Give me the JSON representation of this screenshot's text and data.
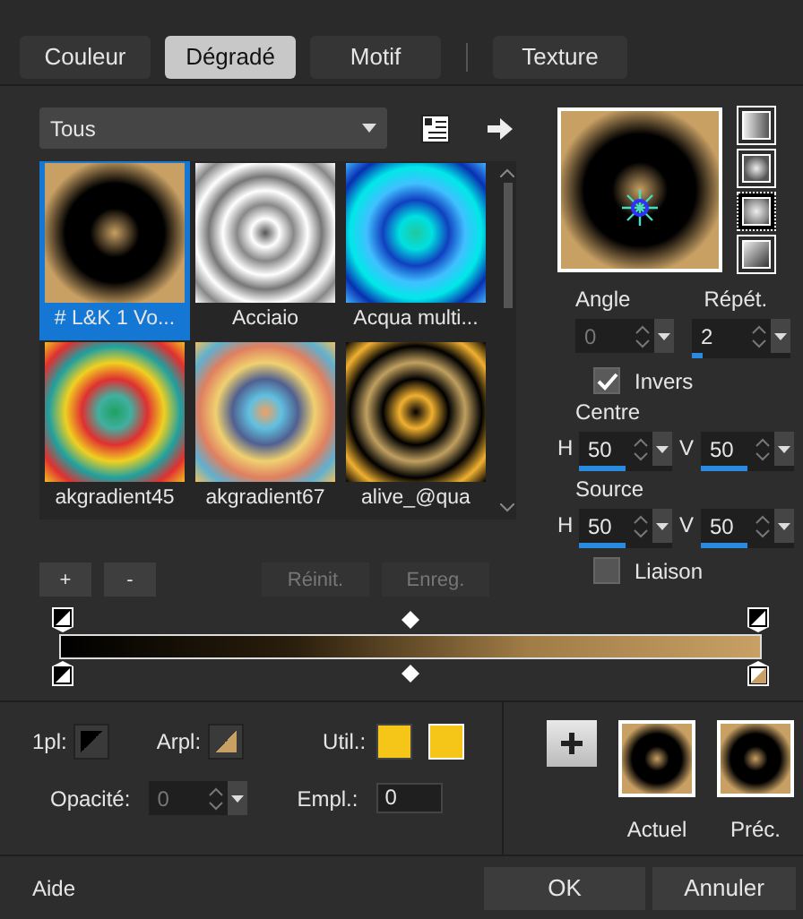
{
  "tabs": [
    {
      "label": "Couleur",
      "selected": false
    },
    {
      "label": "Dégradé",
      "selected": true
    },
    {
      "label": "Motif",
      "selected": false
    },
    {
      "label": "Texture",
      "selected": false
    }
  ],
  "category": {
    "value": "Tous"
  },
  "gradients": [
    {
      "name": "# L&K 1 Vo...",
      "selected": true
    },
    {
      "name": "Acciaio",
      "selected": false
    },
    {
      "name": "Acqua multi...",
      "selected": false
    },
    {
      "name": "akgradient45",
      "selected": false
    },
    {
      "name": "akgradient67",
      "selected": false
    },
    {
      "name": "alive_@qua",
      "selected": false
    }
  ],
  "library_buttons": [
    {
      "label": "+",
      "disabled": false
    },
    {
      "label": "-",
      "disabled": false
    },
    {
      "label": "Réinit.",
      "disabled": true
    },
    {
      "label": "Enreg.",
      "disabled": true
    }
  ],
  "styles": [
    {
      "kind": "linear",
      "selected": false
    },
    {
      "kind": "rectangular",
      "selected": false
    },
    {
      "kind": "radial",
      "selected": true
    },
    {
      "kind": "sunburst",
      "selected": false
    }
  ],
  "angle": {
    "label": "Angle",
    "value": "0",
    "disabled": true
  },
  "repeat": {
    "label": "Répét.",
    "value": "2",
    "disabled": false,
    "level": 0.1
  },
  "invert": {
    "label": "Invers",
    "checked": true
  },
  "centre": {
    "label": "Centre",
    "h": {
      "label": "H",
      "value": "50",
      "level": 0.5
    },
    "v": {
      "label": "V",
      "value": "50",
      "level": 0.5
    }
  },
  "source": {
    "label": "Source",
    "h": {
      "label": "H",
      "value": "50",
      "level": 0.5
    },
    "v": {
      "label": "V",
      "value": "50",
      "level": 0.5
    }
  },
  "link": {
    "label": "Liaison",
    "checked": false
  },
  "stop": {
    "fill_1": {
      "label": "1pl:"
    },
    "fill_2": {
      "label": "Arpl:"
    },
    "user": {
      "label": "Util.:",
      "swatches": [
        {
          "color": "#f5c518"
        },
        {
          "color": "#f5c518"
        }
      ]
    },
    "opacity": {
      "label": "Opacité:",
      "value": "0",
      "disabled": true
    },
    "location": {
      "label": "Empl.:",
      "value": "0"
    }
  },
  "thumbnails": [
    {
      "label": "Actuel"
    },
    {
      "label": "Préc."
    }
  ],
  "help": "Aide",
  "buttons": [
    "OK",
    "Annuler"
  ]
}
